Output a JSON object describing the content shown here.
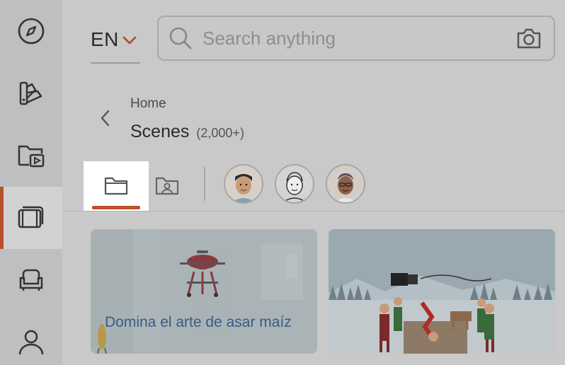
{
  "sidebar": {
    "items": [
      {
        "name": "explore",
        "icon": "compass-icon",
        "active": false
      },
      {
        "name": "design",
        "icon": "palette-icon",
        "active": false
      },
      {
        "name": "media",
        "icon": "video-folder-icon",
        "active": false
      },
      {
        "name": "scenes",
        "icon": "film-icon",
        "active": true
      },
      {
        "name": "props",
        "icon": "armchair-icon",
        "active": false
      },
      {
        "name": "characters",
        "icon": "person-icon",
        "active": false
      }
    ],
    "accent": "#b8512b"
  },
  "header": {
    "language": "EN",
    "search_placeholder": "Search anything"
  },
  "breadcrumb": {
    "home": "Home",
    "title": "Scenes",
    "count": "(2,000+)"
  },
  "tabs": [
    {
      "name": "folder",
      "icon": "folder-icon",
      "active": true
    },
    {
      "name": "character-folder",
      "icon": "person-folder-icon",
      "active": false
    }
  ],
  "avatars": [
    "character-avatar-1",
    "character-avatar-2",
    "character-avatar-3"
  ],
  "cards": [
    {
      "caption": "Domina el arte de asar maíz",
      "thumbnail": "grill-scene"
    },
    {
      "caption": "",
      "thumbnail": "christmas-elves-scene"
    }
  ]
}
